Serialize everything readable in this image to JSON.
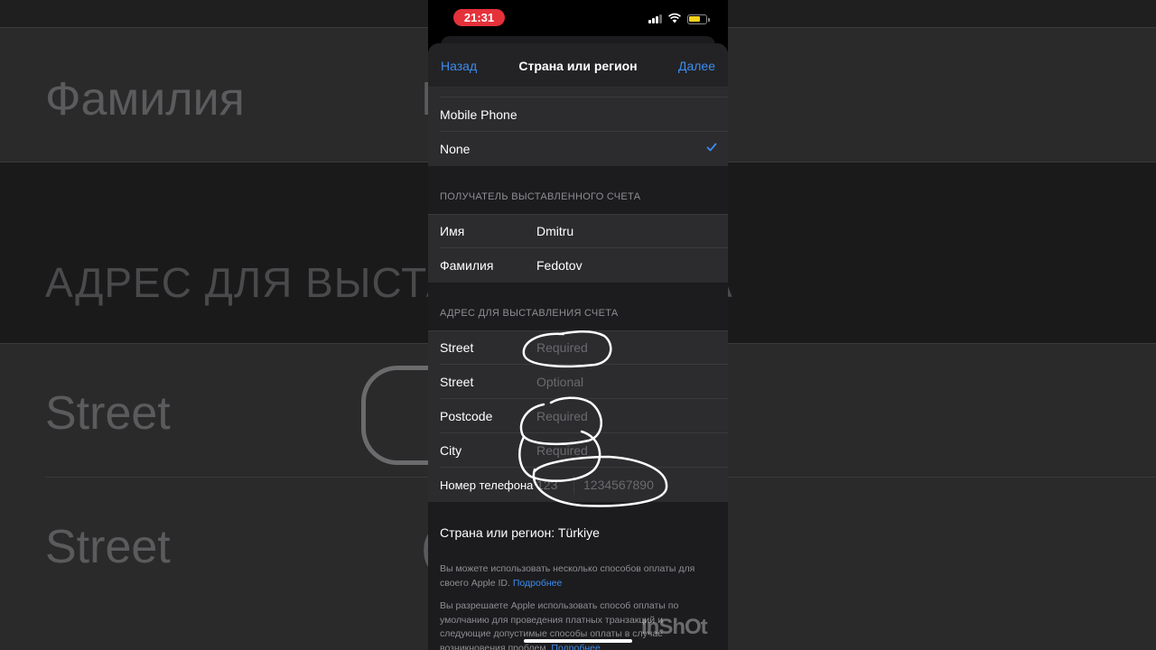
{
  "background": {
    "surname_label": "Фамилия",
    "surname_value_partial": "F",
    "address_header": "АДРЕС ДЛЯ ВЫСТА",
    "address_header_tail": "А",
    "street1_label": "Street",
    "street2_label": "Street",
    "street2_value_partial": "("
  },
  "status_bar": {
    "time": "21:31"
  },
  "nav": {
    "back_label": "Назад",
    "title": "Страна или регион",
    "next_label": "Далее"
  },
  "payment": {
    "partial_row": "",
    "items": [
      {
        "label": "Mobile Phone",
        "selected": false
      },
      {
        "label": "None",
        "selected": true
      }
    ]
  },
  "recipient": {
    "header": "ПОЛУЧАТЕЛЬ ВЫСТАВЛЕННОГО СЧЕТА",
    "first_name_label": "Имя",
    "first_name_value": "Dmitru",
    "last_name_label": "Фамилия",
    "last_name_value": "Fedotov"
  },
  "address": {
    "header": "АДРЕС ДЛЯ ВЫСТАВЛЕНИЯ СЧЕТА",
    "street1_label": "Street",
    "street1_placeholder": "Required",
    "street2_label": "Street",
    "street2_placeholder": "Optional",
    "postcode_label": "Postcode",
    "postcode_placeholder": "Required",
    "city_label": "City",
    "city_placeholder": "Required",
    "phone_label": "Номер телефона",
    "phone_code_placeholder": "123",
    "phone_number_placeholder": "1234567890"
  },
  "country": {
    "label": "Страна или регион: Türkiye"
  },
  "notes": {
    "note1_text": "Вы можете использовать несколько способов оплаты для своего Apple ID.",
    "note1_link": "Подробнее",
    "note2_text": "Вы разрешаете Apple использовать способ оплаты по умолчанию для проведения платных транзакций и следующие допустимые способы оплаты в случае возникновения проблем.",
    "note2_link": "Подробнее"
  },
  "watermark": "InShOt",
  "colors": {
    "accent": "#3d8cf0",
    "time_pill": "#e5313a",
    "battery": "#f7d21b",
    "sheet": "#1c1c1e",
    "cell": "#2c2c2e"
  }
}
